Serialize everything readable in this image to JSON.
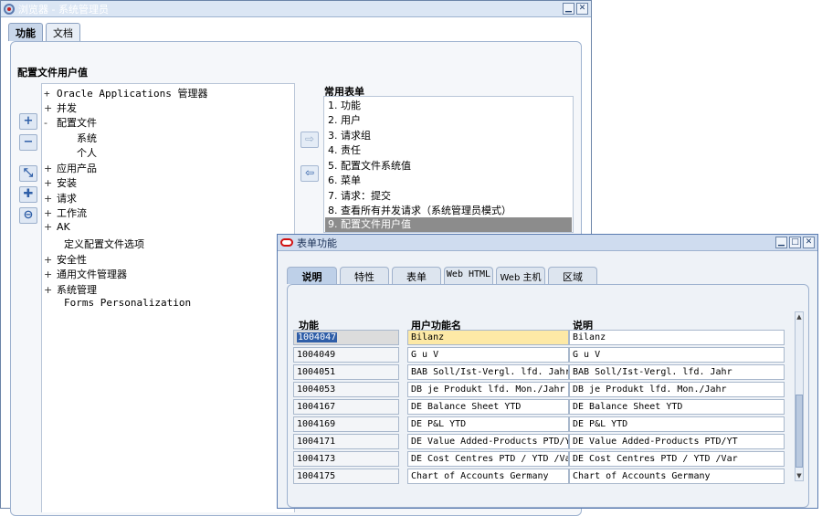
{
  "navigator": {
    "title": "浏览器 - 系统管理员",
    "tabs": [
      "功能",
      "文档"
    ],
    "section_label": "配置文件用户值",
    "common_label": "常用表单",
    "tree": [
      {
        "exp": "+",
        "label": "Oracle Applications 管理器"
      },
      {
        "exp": "+",
        "label": "并发"
      },
      {
        "exp": "-",
        "label": "配置文件"
      },
      {
        "exp": "",
        "label": "系统"
      },
      {
        "exp": "",
        "label": "个人"
      },
      {
        "exp": "+",
        "label": "应用产品"
      },
      {
        "exp": "+",
        "label": "安装"
      },
      {
        "exp": "+",
        "label": "请求"
      },
      {
        "exp": "+",
        "label": "工作流"
      },
      {
        "exp": "+",
        "label": "AK"
      },
      {
        "exp": "",
        "label": "定义配置文件选项"
      },
      {
        "exp": "+",
        "label": "安全性"
      },
      {
        "exp": "+",
        "label": "通用文件管理器"
      },
      {
        "exp": "+",
        "label": "系统管理"
      },
      {
        "exp": "",
        "label": "Forms Personalization"
      }
    ],
    "common_forms": [
      "1. 功能",
      "2. 用户",
      "3. 请求组",
      "4. 责任",
      "5. 配置文件系统值",
      "6. 菜单",
      "7. 请求：提交",
      "8. 查看所有并发请求（系统管理员模式）",
      "9. 配置文件用户值"
    ],
    "side_buttons": [
      "+",
      "−",
      "⤡",
      "✚",
      "⊖"
    ],
    "arrow_buttons": [
      "⇨",
      "⇦"
    ]
  },
  "form_functions": {
    "title": "表单功能",
    "tabs": [
      "说明",
      "特性",
      "表单",
      "Web HTML",
      "Web 主机",
      "区域"
    ],
    "headers": {
      "code": "功能",
      "user_name": "用户功能名",
      "description": "说明"
    },
    "rows": [
      {
        "code": "1004047",
        "user_name": "Bilanz",
        "description": "Bilanz"
      },
      {
        "code": "1004049",
        "user_name": "G u V",
        "description": "G u V"
      },
      {
        "code": "1004051",
        "user_name": "BAB Soll/Ist-Vergl. lfd. Jahr",
        "description": "BAB Soll/Ist-Vergl. lfd. Jahr"
      },
      {
        "code": "1004053",
        "user_name": "DB je Produkt lfd. Mon./Jahr",
        "description": "DB je Produkt lfd. Mon./Jahr"
      },
      {
        "code": "1004167",
        "user_name": "DE Balance Sheet YTD",
        "description": "DE Balance Sheet YTD"
      },
      {
        "code": "1004169",
        "user_name": "DE P&L YTD",
        "description": "DE P&L YTD"
      },
      {
        "code": "1004171",
        "user_name": "DE Value Added-Products PTD/YT",
        "description": "DE Value Added-Products PTD/YT"
      },
      {
        "code": "1004173",
        "user_name": "DE Cost Centres PTD / YTD /Var",
        "description": "DE Cost Centres PTD / YTD /Var"
      },
      {
        "code": "1004175",
        "user_name": "Chart of Accounts Germany",
        "description": "Chart of Accounts Germany"
      }
    ]
  },
  "colors": {
    "selected_row": "#8c8c8c",
    "focus_cell": "#fde9a6",
    "selection": "#2f5ea8"
  }
}
